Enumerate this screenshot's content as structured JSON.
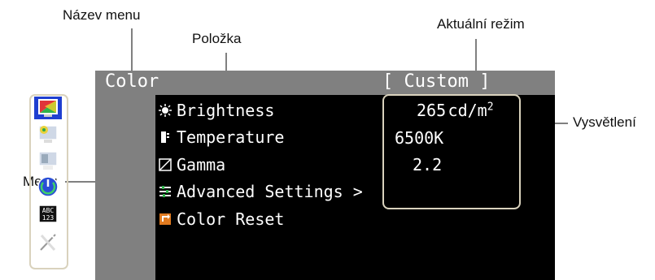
{
  "callouts": {
    "menu_name": "Název menu",
    "item": "Položka",
    "current_mode": "Aktuální režim",
    "menu": "Menu",
    "explanation": "Vysvětlení"
  },
  "osd": {
    "title": "Color",
    "mode": "[ Custom ]",
    "menu_icons": [
      "color-icon",
      "picture-icon",
      "monitor-icon",
      "power-icon",
      "language-icon",
      "tools-icon"
    ],
    "items": [
      {
        "label": "Brightness",
        "icon": "sun-icon"
      },
      {
        "label": "Temperature",
        "icon": "thermometer-icon"
      },
      {
        "label": "Gamma",
        "icon": "gamma-icon"
      },
      {
        "label": "Advanced Settings >",
        "icon": "sliders-icon"
      },
      {
        "label": "Color Reset",
        "icon": "reset-icon"
      }
    ],
    "values": {
      "brightness": "265",
      "brightness_unit": "cd/m",
      "brightness_sup": "2",
      "temperature": "6500K",
      "gamma": "2.2"
    }
  },
  "colors": {
    "osd_bg": "#000000",
    "title_bar": "#808080",
    "highlight": "#1f3fd0",
    "callout_box": "#d9d2bd"
  }
}
